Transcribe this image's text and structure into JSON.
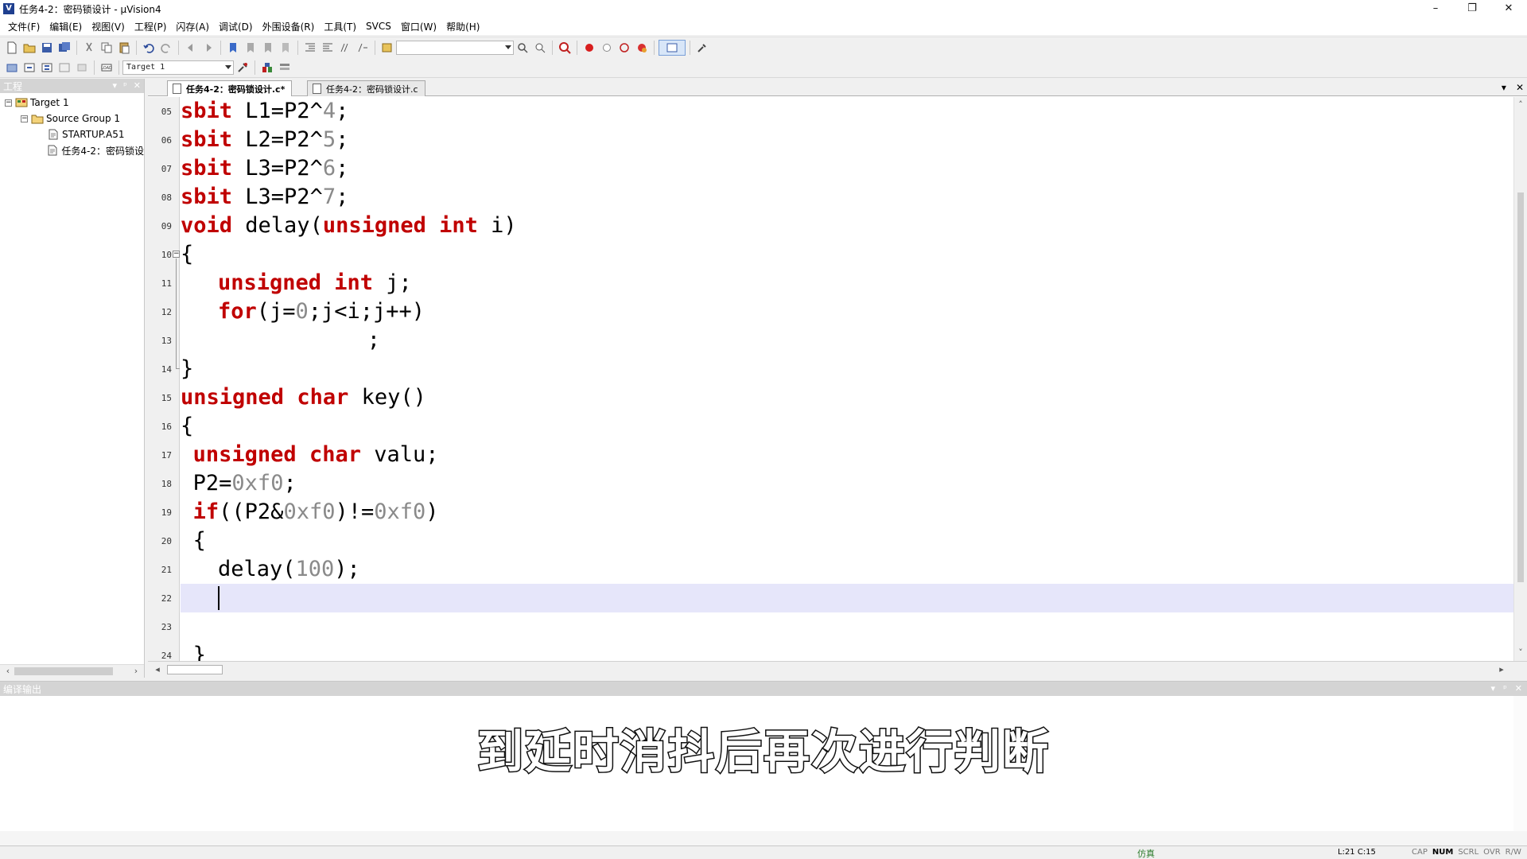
{
  "window": {
    "title": "任务4-2：密码锁设计 - μVision4",
    "app_icon": "uv4-icon",
    "controls": [
      "–",
      "❐",
      "✕"
    ]
  },
  "menu": [
    "文件(F)",
    "编辑(E)",
    "视图(V)",
    "工程(P)",
    "闪存(A)",
    "调试(D)",
    "外围设备(R)",
    "工具(T)",
    "SVCS",
    "窗口(W)",
    "帮助(H)"
  ],
  "toolbar": {
    "target_select": "Target 1"
  },
  "project_panel": {
    "title": "工程",
    "tree": [
      {
        "label": "Target 1",
        "level": 0,
        "expander": "−",
        "icon": "target-icon"
      },
      {
        "label": "Source Group 1",
        "level": 1,
        "expander": "−",
        "icon": "folder-icon"
      },
      {
        "label": "STARTUP.A51",
        "level": 2,
        "expander": "",
        "icon": "file-icon"
      },
      {
        "label": "任务4-2：密码锁设",
        "level": 2,
        "expander": "",
        "icon": "file-icon"
      }
    ]
  },
  "editor": {
    "tabs": [
      {
        "label": "任务4-2：密码锁设计.c*",
        "active": true
      },
      {
        "label": "任务4-2：密码锁设计.c",
        "active": false
      }
    ],
    "current_line": 22,
    "caret_column": 15,
    "lines": [
      {
        "no": "05",
        "indent": 0,
        "tokens": [
          {
            "t": "sbit",
            "c": "kw"
          },
          {
            "t": " L1=P2^",
            "c": ""
          },
          {
            "t": "4",
            "c": "num"
          },
          {
            "t": ";",
            "c": ""
          }
        ]
      },
      {
        "no": "06",
        "indent": 0,
        "tokens": [
          {
            "t": "sbit",
            "c": "kw"
          },
          {
            "t": " L2=P2^",
            "c": ""
          },
          {
            "t": "5",
            "c": "num"
          },
          {
            "t": ";",
            "c": ""
          }
        ]
      },
      {
        "no": "07",
        "indent": 0,
        "tokens": [
          {
            "t": "sbit",
            "c": "kw"
          },
          {
            "t": " L3=P2^",
            "c": ""
          },
          {
            "t": "6",
            "c": "num"
          },
          {
            "t": ";",
            "c": ""
          }
        ]
      },
      {
        "no": "08",
        "indent": 0,
        "tokens": [
          {
            "t": "sbit",
            "c": "kw"
          },
          {
            "t": " L3=P2^",
            "c": ""
          },
          {
            "t": "7",
            "c": "num"
          },
          {
            "t": ";",
            "c": ""
          }
        ]
      },
      {
        "no": "09",
        "indent": 0,
        "tokens": [
          {
            "t": "void",
            "c": "kw"
          },
          {
            "t": " delay(",
            "c": ""
          },
          {
            "t": "unsigned",
            "c": "kw"
          },
          {
            "t": " ",
            "c": ""
          },
          {
            "t": "int",
            "c": "kw"
          },
          {
            "t": " i)",
            "c": ""
          }
        ]
      },
      {
        "no": "10",
        "indent": 0,
        "fold": "−",
        "tokens": [
          {
            "t": "{",
            "c": ""
          }
        ]
      },
      {
        "no": "11",
        "indent": 3,
        "tokens": [
          {
            "t": "unsigned",
            "c": "kw"
          },
          {
            "t": " ",
            "c": ""
          },
          {
            "t": "int",
            "c": "kw"
          },
          {
            "t": " j;",
            "c": ""
          }
        ]
      },
      {
        "no": "12",
        "indent": 3,
        "tokens": [
          {
            "t": "for",
            "c": "kw"
          },
          {
            "t": "(j=",
            "c": ""
          },
          {
            "t": "0",
            "c": "num"
          },
          {
            "t": ";j<i;j++)",
            "c": ""
          }
        ]
      },
      {
        "no": "13",
        "indent": 15,
        "tokens": [
          {
            "t": ";",
            "c": ""
          }
        ]
      },
      {
        "no": "14",
        "indent": 0,
        "tokens": [
          {
            "t": "}",
            "c": ""
          }
        ]
      },
      {
        "no": "15",
        "indent": 0,
        "tokens": [
          {
            "t": "unsigned",
            "c": "kw"
          },
          {
            "t": " ",
            "c": ""
          },
          {
            "t": "char",
            "c": "kw"
          },
          {
            "t": " key()",
            "c": ""
          }
        ]
      },
      {
        "no": "16",
        "indent": 0,
        "tokens": [
          {
            "t": "{",
            "c": ""
          }
        ]
      },
      {
        "no": "17",
        "indent": 1,
        "tokens": [
          {
            "t": "unsigned",
            "c": "kw"
          },
          {
            "t": " ",
            "c": ""
          },
          {
            "t": "char",
            "c": "kw"
          },
          {
            "t": " valu;",
            "c": ""
          }
        ]
      },
      {
        "no": "18",
        "indent": 1,
        "tokens": [
          {
            "t": "P2=",
            "c": ""
          },
          {
            "t": "0xf0",
            "c": "num"
          },
          {
            "t": ";",
            "c": ""
          }
        ]
      },
      {
        "no": "19",
        "indent": 1,
        "tokens": [
          {
            "t": "if",
            "c": "kw"
          },
          {
            "t": "((P2&",
            "c": ""
          },
          {
            "t": "0xf0",
            "c": "num"
          },
          {
            "t": ")!=",
            "c": ""
          },
          {
            "t": "0xf0",
            "c": "num"
          },
          {
            "t": ")",
            "c": ""
          }
        ]
      },
      {
        "no": "20",
        "indent": 1,
        "tokens": [
          {
            "t": "{",
            "c": ""
          }
        ]
      },
      {
        "no": "21",
        "indent": 3,
        "tokens": [
          {
            "t": "delay(",
            "c": ""
          },
          {
            "t": "100",
            "c": "num"
          },
          {
            "t": ");",
            "c": ""
          }
        ]
      },
      {
        "no": "22",
        "indent": 0,
        "tokens": []
      },
      {
        "no": "23",
        "indent": 0,
        "tokens": []
      },
      {
        "no": "24",
        "indent": 1,
        "tokens": [
          {
            "t": "}",
            "c": ""
          }
        ]
      }
    ]
  },
  "build_output": {
    "title": "编译输出"
  },
  "subtitle": "到延时消抖后再次进行判断",
  "statusbar": {
    "mode": "仿真",
    "position": "L:21 C:15",
    "flags": [
      {
        "label": "CAP",
        "on": false
      },
      {
        "label": "NUM",
        "on": true
      },
      {
        "label": "SCRL",
        "on": false
      },
      {
        "label": "OVR",
        "on": false
      },
      {
        "label": "R/W",
        "on": false
      }
    ]
  },
  "colors": {
    "keyword": "#c00000",
    "number": "#8a8a8a",
    "current_line_bg": "#e6e6fa"
  }
}
